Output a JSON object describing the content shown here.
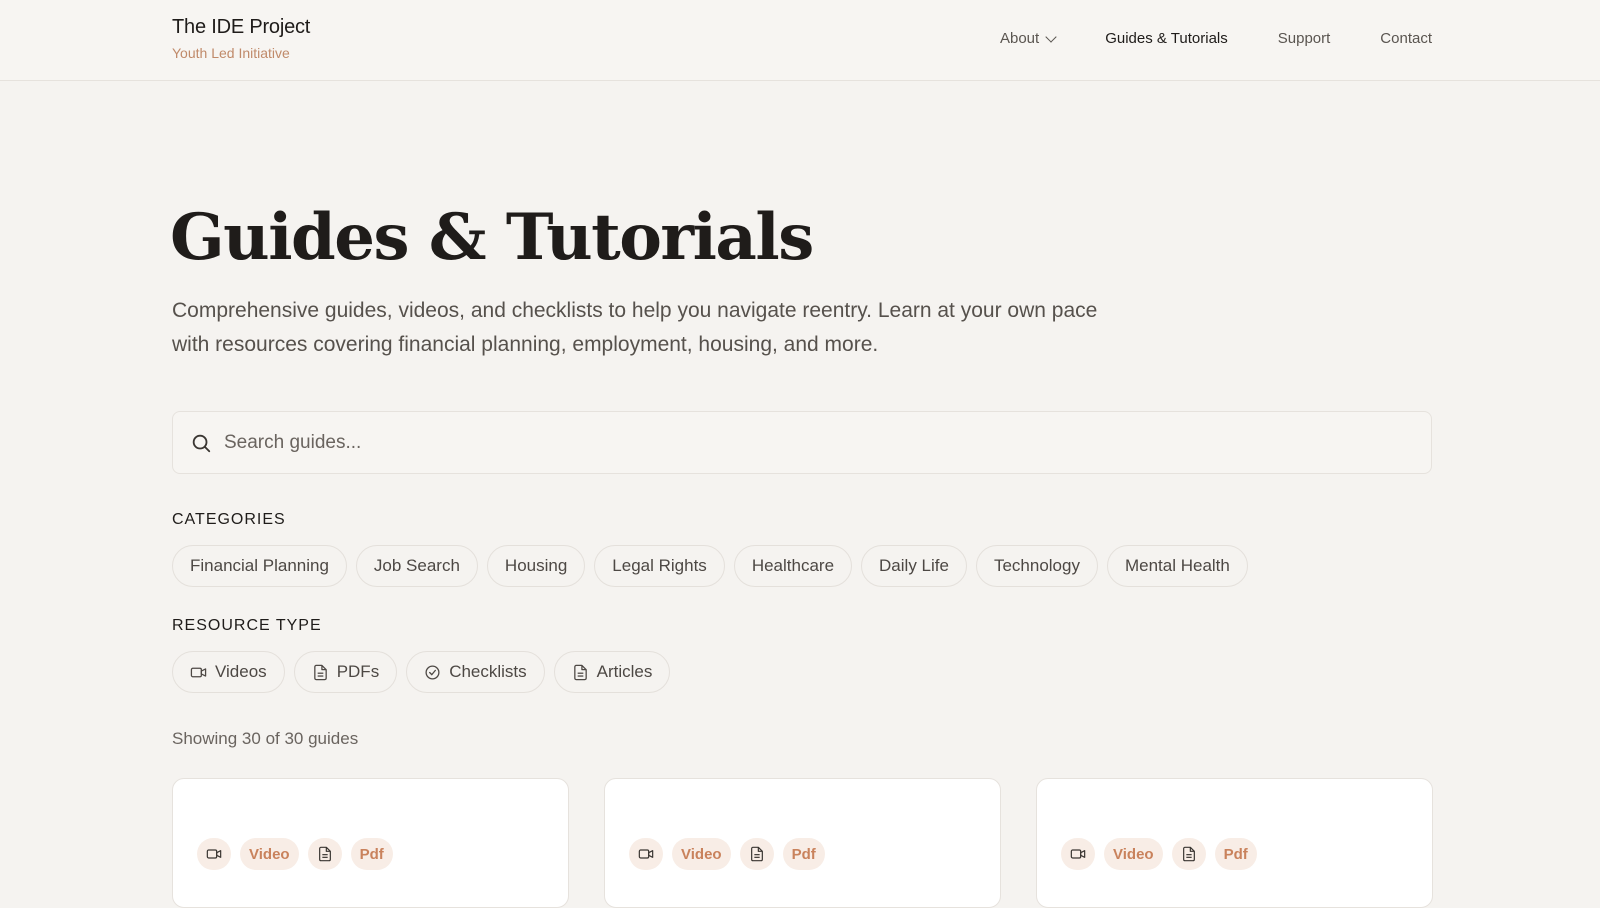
{
  "header": {
    "brand_title": "The IDE Project",
    "brand_subtitle": "Youth Led Initiative",
    "nav": [
      {
        "label": "About",
        "has_dropdown": true
      },
      {
        "label": "Guides & Tutorials",
        "active": true
      },
      {
        "label": "Support"
      },
      {
        "label": "Contact"
      }
    ]
  },
  "hero": {
    "title": "Guides & Tutorials",
    "description": "Comprehensive guides, videos, and checklists to help you navigate reentry. Learn at your own pace with resources covering financial planning, employment, housing, and more."
  },
  "search": {
    "placeholder": "Search guides...",
    "value": ""
  },
  "categories": {
    "label": "CATEGORIES",
    "items": [
      "Financial Planning",
      "Job Search",
      "Housing",
      "Legal Rights",
      "Healthcare",
      "Daily Life",
      "Technology",
      "Mental Health"
    ]
  },
  "resource_type": {
    "label": "RESOURCE TYPE",
    "items": [
      {
        "label": "Videos",
        "icon": "video-icon"
      },
      {
        "label": "PDFs",
        "icon": "document-icon"
      },
      {
        "label": "Checklists",
        "icon": "check-circle-icon"
      },
      {
        "label": "Articles",
        "icon": "document-icon"
      }
    ]
  },
  "results": {
    "count_text": "Showing 30 of 30 guides"
  },
  "cards": [
    {
      "tags": [
        {
          "icon": "video-icon",
          "label": "Video"
        },
        {
          "icon": "document-icon",
          "label": "Pdf"
        }
      ]
    },
    {
      "tags": [
        {
          "icon": "video-icon",
          "label": "Video"
        },
        {
          "icon": "document-icon",
          "label": "Pdf"
        }
      ]
    },
    {
      "tags": [
        {
          "icon": "video-icon",
          "label": "Video"
        },
        {
          "icon": "document-icon",
          "label": "Pdf"
        }
      ]
    }
  ],
  "colors": {
    "accent": "#c9825c",
    "tag_bg": "#f8ede6",
    "page_bg": "#f5f3f0"
  }
}
